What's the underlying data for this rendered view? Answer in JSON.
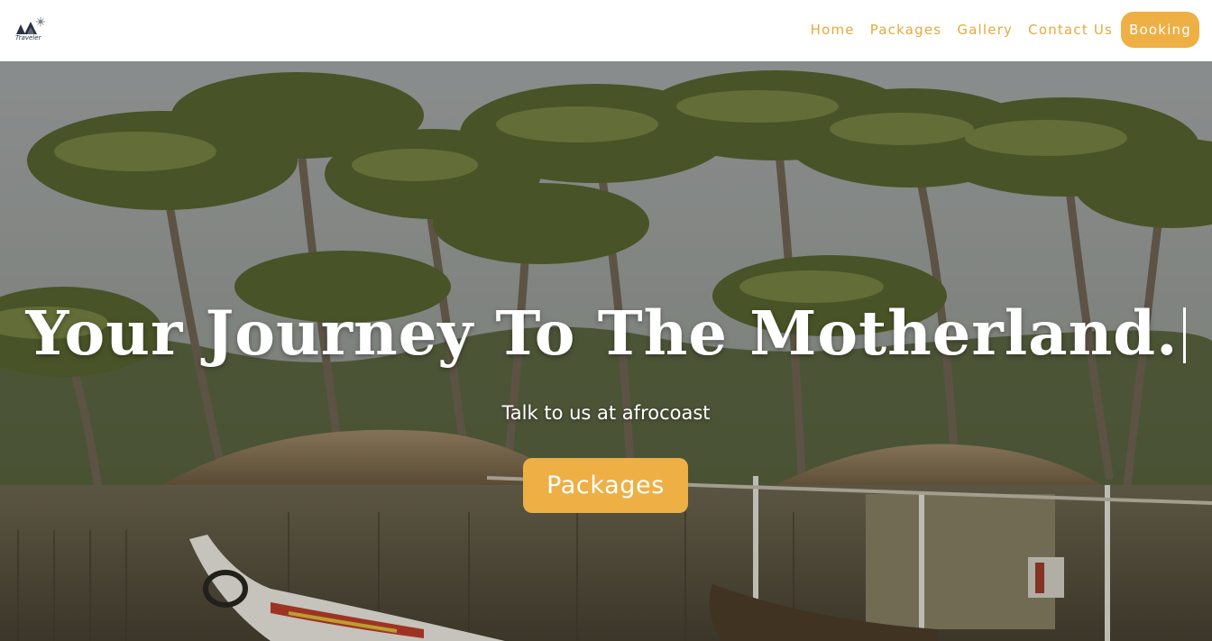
{
  "brand": {
    "logo_text": "Traveler"
  },
  "nav": {
    "items": [
      {
        "label": "Home"
      },
      {
        "label": "Packages"
      },
      {
        "label": "Gallery"
      },
      {
        "label": "Contact Us"
      }
    ],
    "booking_label": "Booking"
  },
  "hero": {
    "title": "Your Journey To The Motherland.",
    "subtitle": "Talk to us at afrocoast",
    "button_label": "Packages",
    "background": "palm-trees-thatched-huts-village-photo"
  },
  "colors": {
    "accent": "#eeaf44",
    "nav_text": "#e8a93c",
    "hero_text": "#ffffff"
  }
}
